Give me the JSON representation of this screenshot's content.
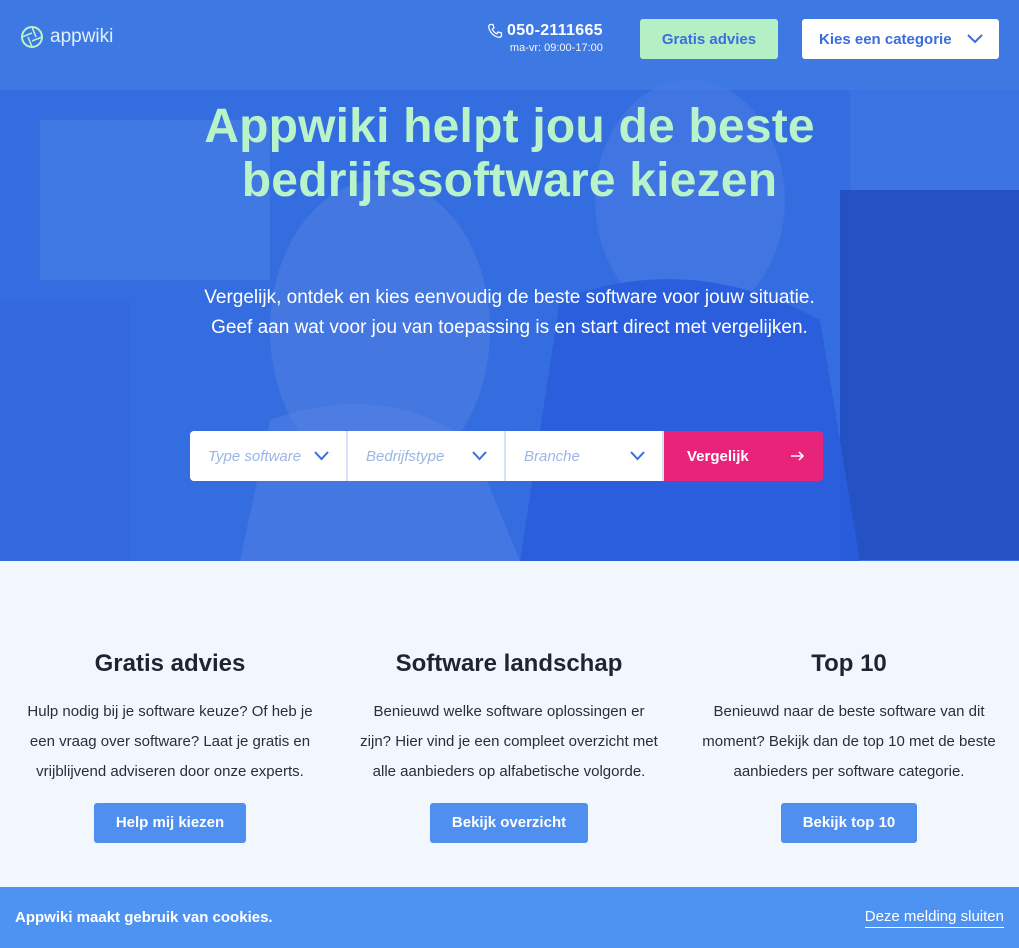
{
  "brand": {
    "name": "appwiki"
  },
  "header": {
    "phone": "050-2111665",
    "hours": "ma-vr: 09:00-17:00",
    "advice_button": "Gratis advies",
    "category_select": "Kies een categorie"
  },
  "hero": {
    "title": "Appwiki helpt jou de beste bedrijfssoftware kiezen",
    "subtitle": "Vergelijk, ontdek en kies eenvoudig de beste software voor jouw situatie. Geef aan wat voor jou van toepassing is en start direct met vergelijken.",
    "filters": {
      "software_type": "Type software",
      "company_type": "Bedrijfstype",
      "industry": "Branche"
    },
    "compare_button": "Vergelijk"
  },
  "features": [
    {
      "title": "Gratis advies",
      "text": "Hulp nodig bij je software keuze? Of heb je een vraag over software? Laat je gratis en vrijblijvend adviseren door onze experts.",
      "button": "Help mij kiezen"
    },
    {
      "title": "Software landschap",
      "text": "Benieuwd welke software oplossingen er zijn? Hier vind je een compleet overzicht met alle aanbieders op alfabetische volgorde.",
      "button": "Bekijk overzicht"
    },
    {
      "title": "Top 10",
      "text": "Benieuwd naar de beste software van dit moment? Bekijk dan de top 10 met de beste aanbieders per software categorie.",
      "button": "Bekijk top 10"
    }
  ],
  "cookie": {
    "message": "Appwiki maakt gebruik van cookies.",
    "close_label": "Deze melding sluiten"
  },
  "colors": {
    "hero_blue": "#2f66dc",
    "accent_green": "#b4f0c4",
    "accent_pink": "#e8237a",
    "button_blue": "#4f8fef",
    "cookie_blue": "#4f93f2"
  }
}
